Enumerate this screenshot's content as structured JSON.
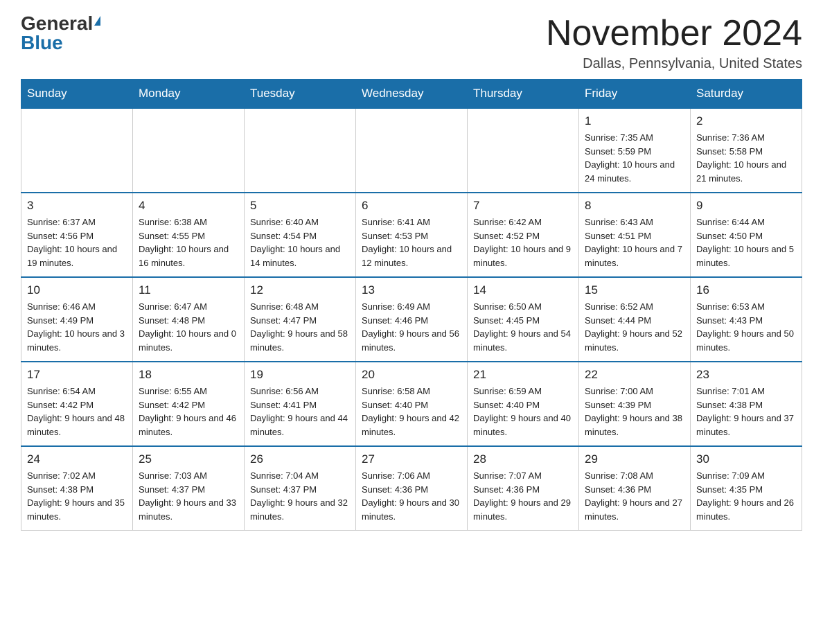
{
  "logo": {
    "general": "General",
    "blue": "Blue"
  },
  "title": "November 2024",
  "location": "Dallas, Pennsylvania, United States",
  "days_of_week": [
    "Sunday",
    "Monday",
    "Tuesday",
    "Wednesday",
    "Thursday",
    "Friday",
    "Saturday"
  ],
  "weeks": [
    [
      {
        "day": "",
        "info": ""
      },
      {
        "day": "",
        "info": ""
      },
      {
        "day": "",
        "info": ""
      },
      {
        "day": "",
        "info": ""
      },
      {
        "day": "",
        "info": ""
      },
      {
        "day": "1",
        "info": "Sunrise: 7:35 AM\nSunset: 5:59 PM\nDaylight: 10 hours and 24 minutes."
      },
      {
        "day": "2",
        "info": "Sunrise: 7:36 AM\nSunset: 5:58 PM\nDaylight: 10 hours and 21 minutes."
      }
    ],
    [
      {
        "day": "3",
        "info": "Sunrise: 6:37 AM\nSunset: 4:56 PM\nDaylight: 10 hours and 19 minutes."
      },
      {
        "day": "4",
        "info": "Sunrise: 6:38 AM\nSunset: 4:55 PM\nDaylight: 10 hours and 16 minutes."
      },
      {
        "day": "5",
        "info": "Sunrise: 6:40 AM\nSunset: 4:54 PM\nDaylight: 10 hours and 14 minutes."
      },
      {
        "day": "6",
        "info": "Sunrise: 6:41 AM\nSunset: 4:53 PM\nDaylight: 10 hours and 12 minutes."
      },
      {
        "day": "7",
        "info": "Sunrise: 6:42 AM\nSunset: 4:52 PM\nDaylight: 10 hours and 9 minutes."
      },
      {
        "day": "8",
        "info": "Sunrise: 6:43 AM\nSunset: 4:51 PM\nDaylight: 10 hours and 7 minutes."
      },
      {
        "day": "9",
        "info": "Sunrise: 6:44 AM\nSunset: 4:50 PM\nDaylight: 10 hours and 5 minutes."
      }
    ],
    [
      {
        "day": "10",
        "info": "Sunrise: 6:46 AM\nSunset: 4:49 PM\nDaylight: 10 hours and 3 minutes."
      },
      {
        "day": "11",
        "info": "Sunrise: 6:47 AM\nSunset: 4:48 PM\nDaylight: 10 hours and 0 minutes."
      },
      {
        "day": "12",
        "info": "Sunrise: 6:48 AM\nSunset: 4:47 PM\nDaylight: 9 hours and 58 minutes."
      },
      {
        "day": "13",
        "info": "Sunrise: 6:49 AM\nSunset: 4:46 PM\nDaylight: 9 hours and 56 minutes."
      },
      {
        "day": "14",
        "info": "Sunrise: 6:50 AM\nSunset: 4:45 PM\nDaylight: 9 hours and 54 minutes."
      },
      {
        "day": "15",
        "info": "Sunrise: 6:52 AM\nSunset: 4:44 PM\nDaylight: 9 hours and 52 minutes."
      },
      {
        "day": "16",
        "info": "Sunrise: 6:53 AM\nSunset: 4:43 PM\nDaylight: 9 hours and 50 minutes."
      }
    ],
    [
      {
        "day": "17",
        "info": "Sunrise: 6:54 AM\nSunset: 4:42 PM\nDaylight: 9 hours and 48 minutes."
      },
      {
        "day": "18",
        "info": "Sunrise: 6:55 AM\nSunset: 4:42 PM\nDaylight: 9 hours and 46 minutes."
      },
      {
        "day": "19",
        "info": "Sunrise: 6:56 AM\nSunset: 4:41 PM\nDaylight: 9 hours and 44 minutes."
      },
      {
        "day": "20",
        "info": "Sunrise: 6:58 AM\nSunset: 4:40 PM\nDaylight: 9 hours and 42 minutes."
      },
      {
        "day": "21",
        "info": "Sunrise: 6:59 AM\nSunset: 4:40 PM\nDaylight: 9 hours and 40 minutes."
      },
      {
        "day": "22",
        "info": "Sunrise: 7:00 AM\nSunset: 4:39 PM\nDaylight: 9 hours and 38 minutes."
      },
      {
        "day": "23",
        "info": "Sunrise: 7:01 AM\nSunset: 4:38 PM\nDaylight: 9 hours and 37 minutes."
      }
    ],
    [
      {
        "day": "24",
        "info": "Sunrise: 7:02 AM\nSunset: 4:38 PM\nDaylight: 9 hours and 35 minutes."
      },
      {
        "day": "25",
        "info": "Sunrise: 7:03 AM\nSunset: 4:37 PM\nDaylight: 9 hours and 33 minutes."
      },
      {
        "day": "26",
        "info": "Sunrise: 7:04 AM\nSunset: 4:37 PM\nDaylight: 9 hours and 32 minutes."
      },
      {
        "day": "27",
        "info": "Sunrise: 7:06 AM\nSunset: 4:36 PM\nDaylight: 9 hours and 30 minutes."
      },
      {
        "day": "28",
        "info": "Sunrise: 7:07 AM\nSunset: 4:36 PM\nDaylight: 9 hours and 29 minutes."
      },
      {
        "day": "29",
        "info": "Sunrise: 7:08 AM\nSunset: 4:36 PM\nDaylight: 9 hours and 27 minutes."
      },
      {
        "day": "30",
        "info": "Sunrise: 7:09 AM\nSunset: 4:35 PM\nDaylight: 9 hours and 26 minutes."
      }
    ]
  ]
}
